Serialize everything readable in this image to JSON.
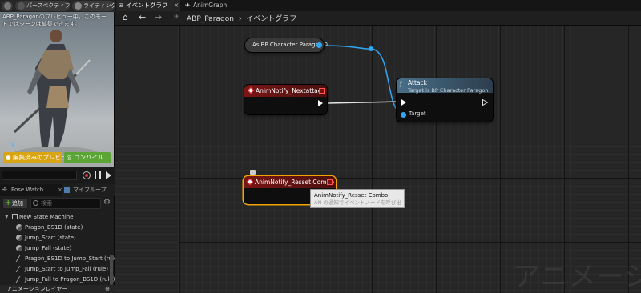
{
  "viewport": {
    "perspective_label": "パースペクティブ",
    "lighting_label": "ライティング",
    "preview_text": "ABP_Paragonのプレビュー中。このモードではシーンは編集できます。",
    "unsaved_preview_label": "編集済みのプレビュ",
    "compile_label": "コンパイル"
  },
  "pose_panel": {
    "tab_pose_watch": "Pose Watch...",
    "tab_my_blueprint": "マイブループ...",
    "add_label": "追加",
    "search_placeholder": "検索",
    "tree": [
      {
        "label": "New State Machine",
        "kind": "machine"
      },
      {
        "label": "Pragon_BS1D (state)",
        "kind": "state"
      },
      {
        "label": "Jump_Start (state)",
        "kind": "state"
      },
      {
        "label": "Jump_Fall (state)",
        "kind": "state"
      },
      {
        "label": "Pragon_BS1D to Jump_Start (rule)",
        "kind": "rule"
      },
      {
        "label": "Jump_Start to Jump_Fall (rule)",
        "kind": "rule"
      },
      {
        "label": "Jump_Fall to Pragon_BS1D (rule)",
        "kind": "rule"
      }
    ],
    "anim_layers_label": "アニメーションレイヤー"
  },
  "tabs": {
    "event_graph": "イベントグラフ",
    "anim_graph": "AnimGraph"
  },
  "breadcrumb": {
    "asset": "ABP_Paragon",
    "separator": "›",
    "graph": "イベントグラフ"
  },
  "nodes": {
    "cast": {
      "title": "As BP Character Paragon 0"
    },
    "notify_next": {
      "title": "AnimNotify_Nextattack"
    },
    "attack": {
      "title": "Attack",
      "subtitle": "Target is BP Character Paragon",
      "target_label": "Target"
    },
    "notify_reset": {
      "title": "AnimNotify_Resset Combo"
    }
  },
  "tooltip": {
    "title": "AnimNotify_Resset Combo",
    "body": "AN の通知でイベントノードを呼び出し"
  },
  "watermark": "アニメーショ",
  "colors": {
    "event_node_header": "#7a1515",
    "attack_header": "#4a6f8a",
    "data_pin": "#2fa7f3",
    "selection": "#f0a400"
  }
}
